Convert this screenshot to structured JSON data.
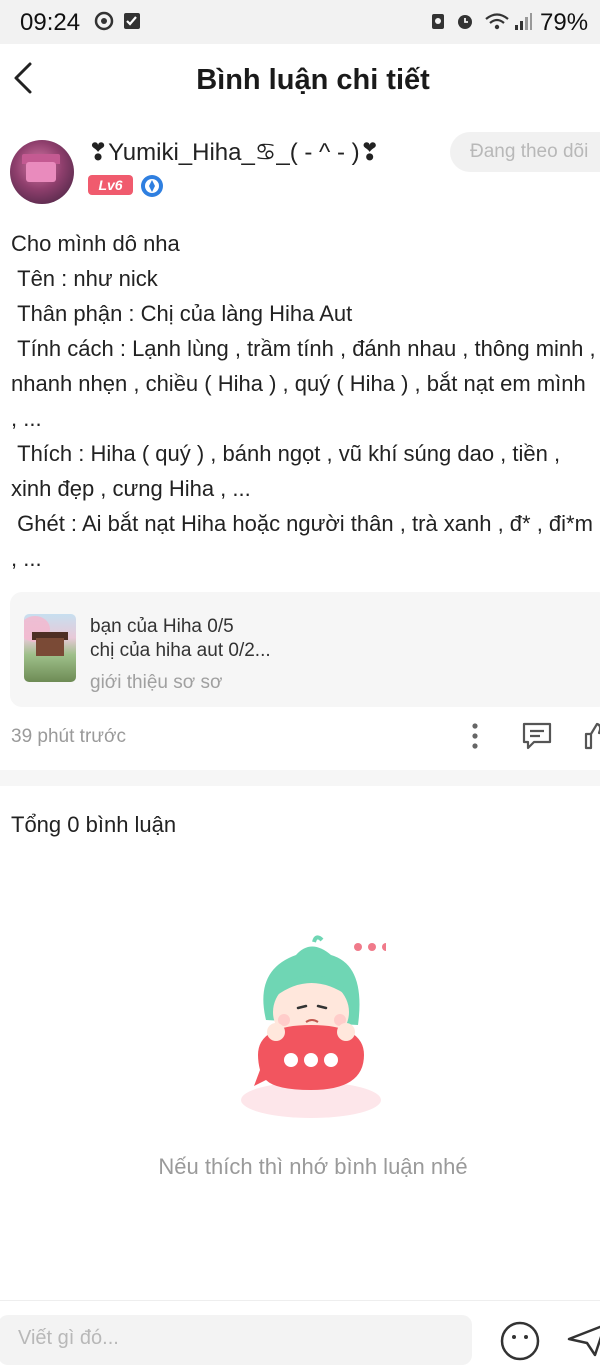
{
  "status_bar": {
    "time": "09:24",
    "battery": "79%"
  },
  "header": {
    "title": "Bình luận chi tiết"
  },
  "post": {
    "username": "❣Yumiki_Hiha_♋_( - ^ - )❣",
    "level": "Lv6",
    "follow_label": "Đang theo dõi",
    "content": "Cho mình dô nha\n Tên : như nick\n Thân phận : Chị của làng Hiha Aut\n Tính cách : Lạnh lùng , trầm tính , đánh nhau , thông minh , nhanh nhẹn , chiều ( Hiha ) , quý ( Hiha ) , bắt nạt em mình , ...\n Thích : Hiha ( quý ) , bánh ngọt , vũ khí súng dao , tiền , xinh đẹp , cưng Hiha , ...\n Ghét : Ai bắt nạt Hiha hoặc người thân , trà xanh , đ* , đi*m , ...",
    "linked_card": {
      "line1": "bạn của Hiha 0/5",
      "line2": "chị của hiha aut 0/2...",
      "line3": "giới thiệu sơ sơ"
    },
    "timestamp": "39 phút trước"
  },
  "comments": {
    "total_label": "Tổng 0 bình luận",
    "empty_text": "Nếu thích thì nhớ bình luận nhé"
  },
  "bottom_bar": {
    "input_placeholder": "Viết gì đó..."
  },
  "colors": {
    "accent": "#f05b6e",
    "badge_blue": "#2f7fe0",
    "mascot_hair": "#6fd6b4"
  }
}
